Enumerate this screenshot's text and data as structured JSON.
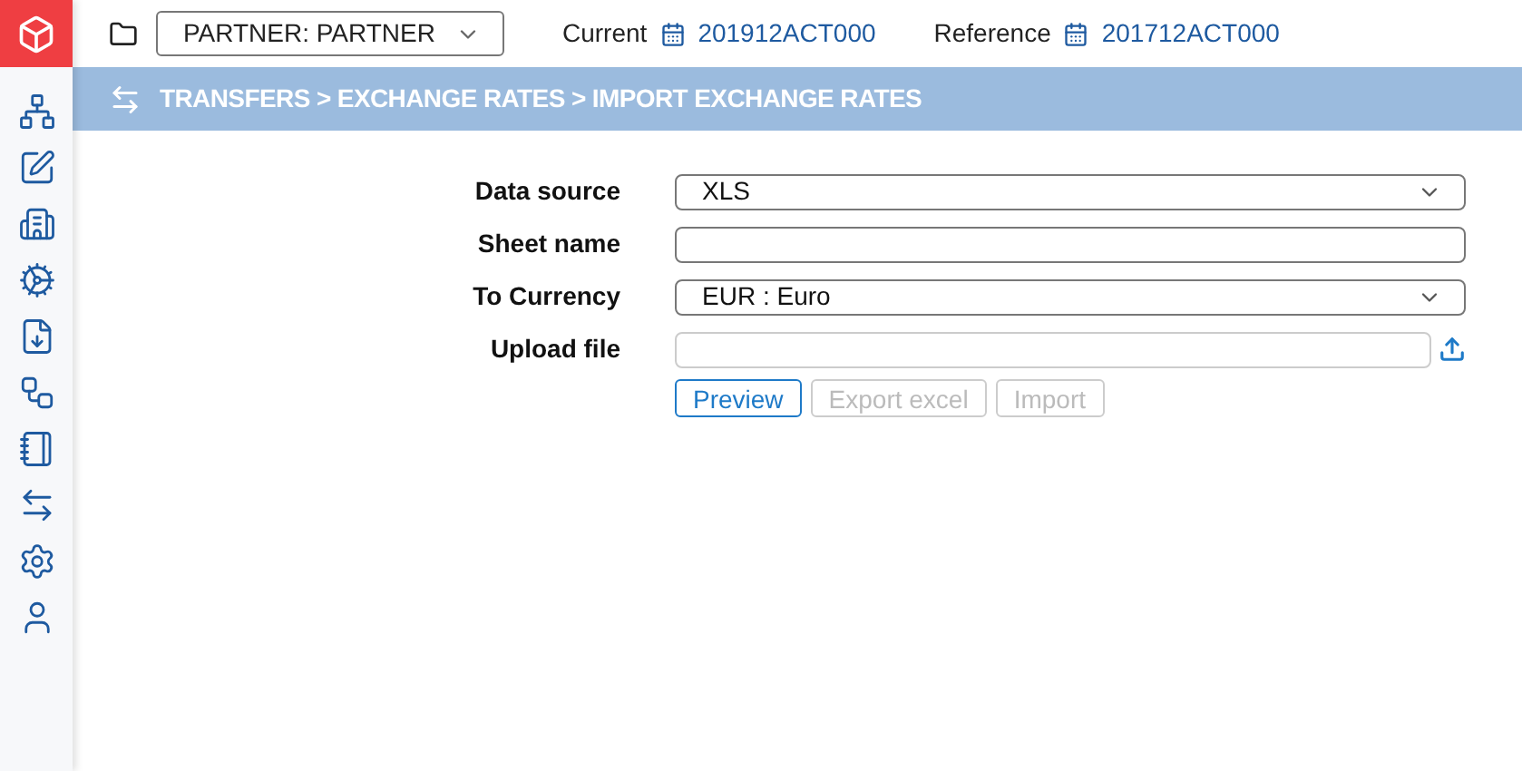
{
  "header": {
    "partner_select": {
      "value": "PARTNER: PARTNER"
    },
    "periods": [
      {
        "label": "Current",
        "value": "201912ACT000"
      },
      {
        "label": "Reference",
        "value": "201712ACT000"
      }
    ]
  },
  "breadcrumb": "TRANSFERS > EXCHANGE RATES > IMPORT EXCHANGE RATES",
  "form": {
    "fields": [
      {
        "label": "Data source",
        "kind": "select",
        "value": "XLS"
      },
      {
        "label": "Sheet name",
        "kind": "text"
      },
      {
        "label": "To Currency",
        "kind": "select",
        "value": "EUR : Euro"
      },
      {
        "label": "Upload file",
        "kind": "file"
      }
    ],
    "buttons": [
      {
        "label": "Preview",
        "disabled": false
      },
      {
        "label": "Export excel",
        "disabled": true
      },
      {
        "label": "Import",
        "disabled": true
      }
    ]
  }
}
